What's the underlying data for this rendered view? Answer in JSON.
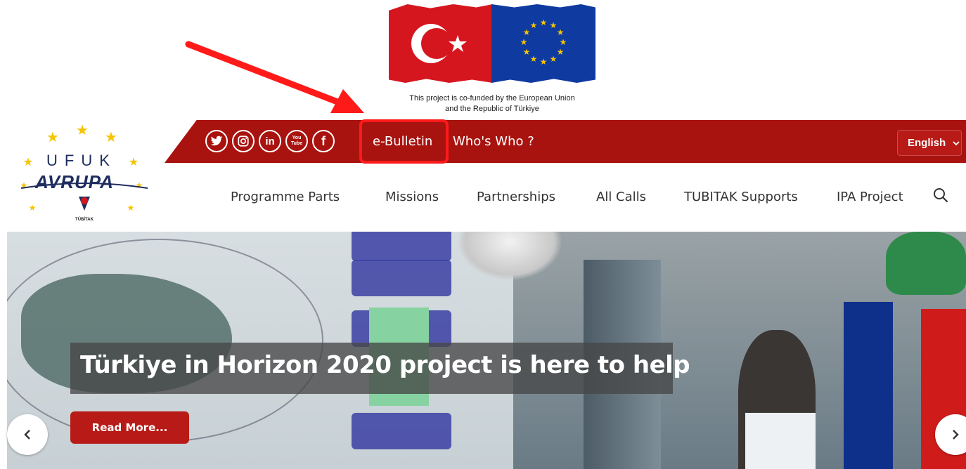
{
  "cofund": {
    "line1": "This project is co-funded by the European Union",
    "line2": "and the Republic of Türkiye"
  },
  "logo": {
    "ufuk": "UFUK",
    "avrupa": "AVRUPA",
    "tubitak": "TÜBİTAK"
  },
  "social": {
    "twitter": "twitter-icon",
    "instagram": "instagram-icon",
    "linkedin": "linkedin-icon",
    "youtube": "youtube-icon",
    "facebook": "facebook-icon",
    "linkedin_glyph": "in",
    "youtube_glyph": "You Tube",
    "facebook_glyph": "f"
  },
  "topbar": {
    "ebulletin": "e-Bulletin",
    "whoswho": "Who's Who ?",
    "language": "English"
  },
  "mainnav": {
    "items": [
      "Programme Parts",
      "Missions",
      "Partnerships",
      "All Calls",
      "TUBITAK Supports",
      "IPA Project"
    ]
  },
  "hero": {
    "headline": "Türkiye in Horizon 2020 project is here to help",
    "readmore": "Read More..."
  },
  "colors": {
    "brand_red": "#a8130f",
    "button_red": "#b81b17",
    "annotation_red": "#ff1a1a",
    "logo_blue": "#1e2d5e",
    "star_yellow": "#f5c400"
  }
}
